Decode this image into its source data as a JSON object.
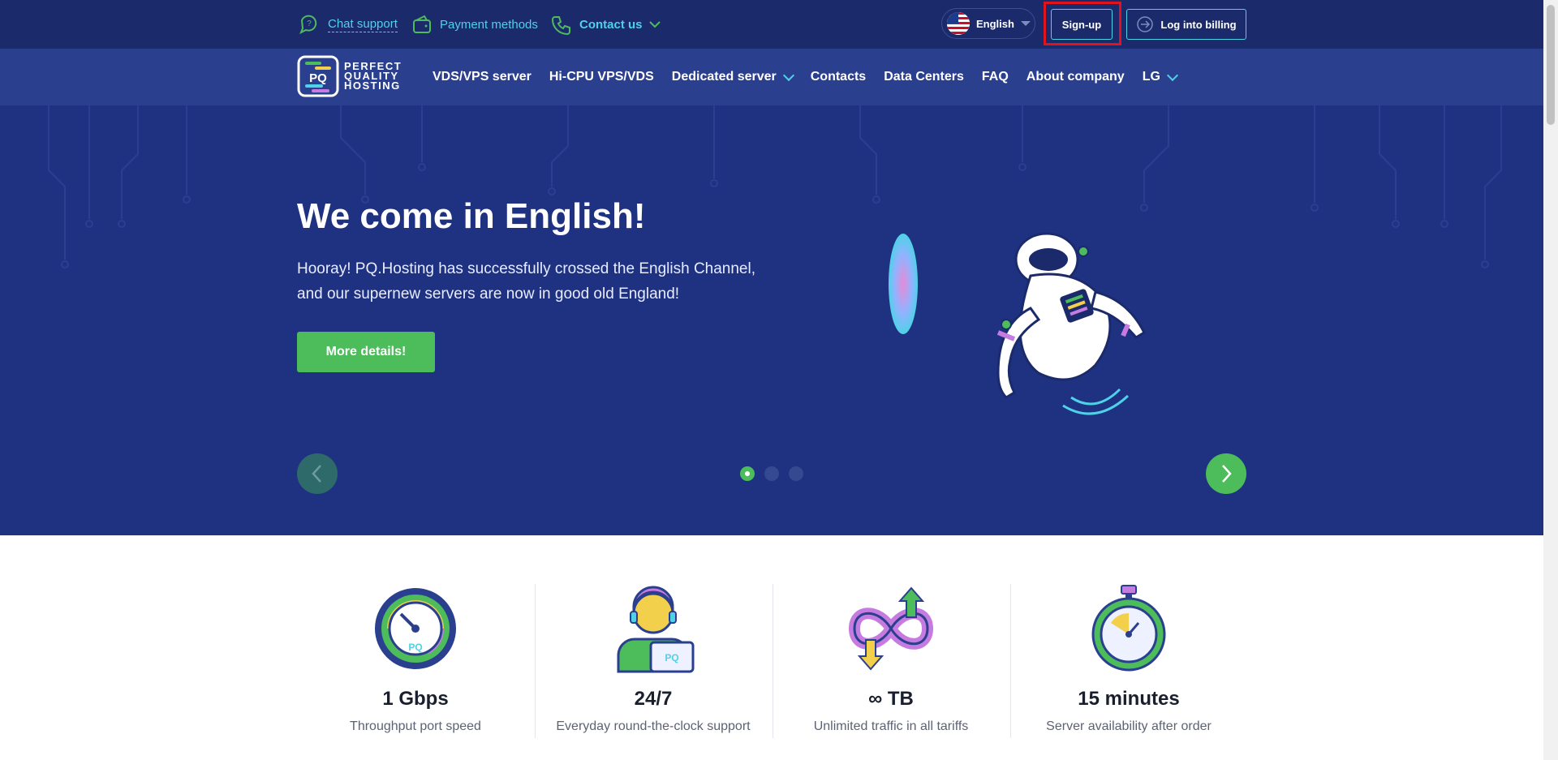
{
  "topbar": {
    "chat_support": "Chat support",
    "payment_methods": "Payment methods",
    "contact_us": "Contact us",
    "language": "English",
    "signup": "Sign-up",
    "login": "Log into billing"
  },
  "logo": {
    "line1": "PERFECT",
    "line2": "QUALITY",
    "line3": "HOSTING"
  },
  "nav": {
    "items": [
      {
        "label": "VDS/VPS server"
      },
      {
        "label": "Hi-CPU VPS/VDS"
      },
      {
        "label": "Dedicated server"
      },
      {
        "label": "Contacts"
      },
      {
        "label": "Data Centers"
      },
      {
        "label": "FAQ"
      },
      {
        "label": "About company"
      },
      {
        "label": "LG"
      }
    ]
  },
  "hero": {
    "title": "We come in English!",
    "text": "Hooray! PQ.Hosting has successfully crossed the English Channel, and our supernew servers are now in good old England!",
    "button": "More details!",
    "slides_total": 3,
    "active_slide": 1
  },
  "features": [
    {
      "value": "1 Gbps",
      "desc": "Throughput port speed",
      "icon": "speedometer-icon"
    },
    {
      "value": "24/7",
      "desc": "Everyday round-the-clock support",
      "icon": "support-agent-icon"
    },
    {
      "value": "∞ TB",
      "desc": "Unlimited traffic in all tariffs",
      "icon": "infinity-traffic-icon"
    },
    {
      "value": "15 minutes",
      "desc": "Server availability after order",
      "icon": "stopwatch-icon"
    }
  ],
  "colors": {
    "topbar": "#1b2a6b",
    "navbar": "#2b3f8f",
    "hero": "#1f3282",
    "accent_cyan": "#4fd1e8",
    "accent_green": "#4dbd5b",
    "highlight_red": "#e0141c"
  }
}
